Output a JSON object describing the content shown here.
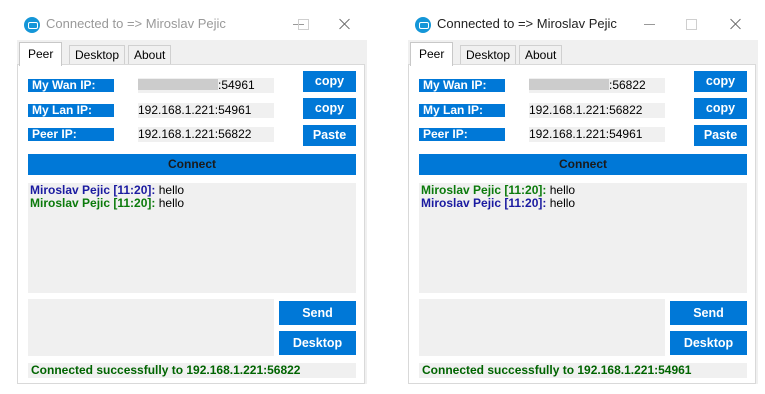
{
  "windows": [
    {
      "title": "Connected to => Miroslav Pejic",
      "tabs": [
        "Peer",
        "Desktop",
        "About"
      ],
      "active_tab": "Peer",
      "wan_ip": {
        "label": "My Wan IP:",
        "value": ":54961",
        "button": "copy"
      },
      "lan_ip": {
        "label": "My Lan IP:",
        "value": "192.168.1.221:54961",
        "button": "copy"
      },
      "peer_ip": {
        "label": "Peer IP:",
        "value": "192.168.1.221:56822",
        "button": "Paste"
      },
      "connect_label": "Connect",
      "chat": [
        {
          "author": "Miroslav Pejic [11:20]:",
          "text": " hello",
          "color": "#1a1aa0"
        },
        {
          "author": "Miroslav Pejic [11:20]:",
          "text": " hello",
          "color": "#0b7a0b"
        }
      ],
      "send_label": "Send",
      "desktop_label": "Desktop",
      "status": "Connected successfully to 192.168.1.221:56822"
    },
    {
      "title": "Connected to => Miroslav Pejic",
      "tabs": [
        "Peer",
        "Desktop",
        "About"
      ],
      "active_tab": "Peer",
      "wan_ip": {
        "label": "My Wan IP:",
        "value": ":56822",
        "button": "copy"
      },
      "lan_ip": {
        "label": "My Lan IP:",
        "value": "192.168.1.221:56822",
        "button": "copy"
      },
      "peer_ip": {
        "label": "Peer IP:",
        "value": "192.168.1.221:54961",
        "button": "Paste"
      },
      "connect_label": "Connect",
      "chat": [
        {
          "author": "Miroslav Pejic [11:20]:",
          "text": " hello",
          "color": "#0b7a0b"
        },
        {
          "author": "Miroslav Pejic [11:20]:",
          "text": " hello",
          "color": "#1a1aa0"
        }
      ],
      "send_label": "Send",
      "desktop_label": "Desktop",
      "status": "Connected successfully to 192.168.1.221:54961"
    }
  ],
  "colors": {
    "accent": "#0078d7",
    "status_text": "#006400",
    "field_bg": "#f0f0f0"
  }
}
